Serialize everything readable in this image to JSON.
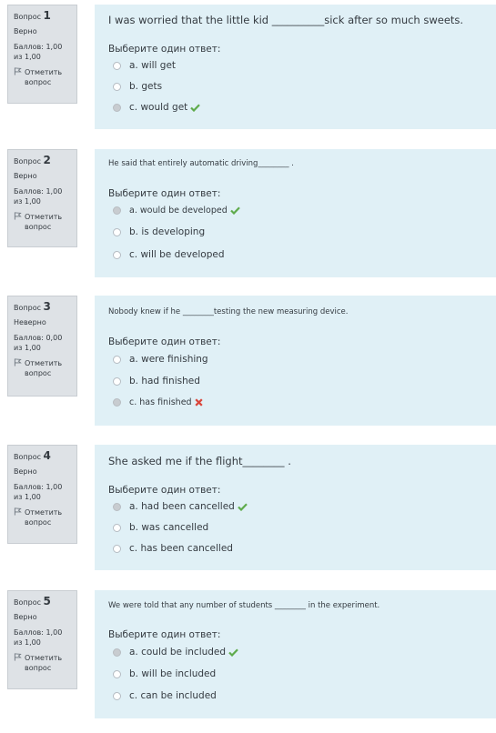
{
  "colors": {
    "info_bg": "#dee2e6",
    "content_bg": "#e0f0f6",
    "correct": "#5fab4c",
    "incorrect": "#d9463b"
  },
  "questions": [
    {
      "label": "Вопрос",
      "number": "1",
      "state": "Верно",
      "grade": "Баллов: 1,00 из 1,00",
      "flag_label": "Отметить вопрос",
      "text": "I was worried that the little kid __________sick after so much sweets.",
      "prompt": "Выберите один ответ:",
      "options": [
        {
          "label": "a. will get",
          "selected": false,
          "mark": ""
        },
        {
          "label": "b. gets",
          "selected": false,
          "mark": ""
        },
        {
          "label": "c. would get",
          "selected": true,
          "mark": "check-icon"
        }
      ]
    },
    {
      "label": "Вопрос",
      "number": "2",
      "state": "Верно",
      "grade": "Баллов: 1,00 из 1,00",
      "flag_label": "Отметить вопрос",
      "text": "He said that entirely automatic driving________ .",
      "prompt": "Выберите один ответ:",
      "options": [
        {
          "label": "a. would be developed",
          "selected": true,
          "mark": "check-icon"
        },
        {
          "label": "b. is developing",
          "selected": false,
          "mark": ""
        },
        {
          "label": "c. will be developed",
          "selected": false,
          "mark": ""
        }
      ]
    },
    {
      "label": "Вопрос",
      "number": "3",
      "state": "Неверно",
      "grade": "Баллов: 0,00 из 1,00",
      "flag_label": "Отметить вопрос",
      "text": "Nobody knew if he ________testing the new measuring device.",
      "prompt": "Выберите один ответ:",
      "options": [
        {
          "label": "a. were finishing",
          "selected": false,
          "mark": ""
        },
        {
          "label": "b. had finished",
          "selected": false,
          "mark": ""
        },
        {
          "label": "c. has finished",
          "selected": true,
          "mark": "cross-icon"
        }
      ]
    },
    {
      "label": "Вопрос",
      "number": "4",
      "state": "Верно",
      "grade": "Баллов: 1,00 из 1,00",
      "flag_label": "Отметить вопрос",
      "text": "She asked me if the flight________ .",
      "prompt": "Выберите один ответ:",
      "options": [
        {
          "label": "a. had been cancelled",
          "selected": true,
          "mark": "check-icon"
        },
        {
          "label": "b. was cancelled",
          "selected": false,
          "mark": ""
        },
        {
          "label": "c. has been cancelled",
          "selected": false,
          "mark": ""
        }
      ]
    },
    {
      "label": "Вопрос",
      "number": "5",
      "state": "Верно",
      "grade": "Баллов: 1,00 из 1,00",
      "flag_label": "Отметить вопрос",
      "text": "We were told that any number of students ________ in the experiment.",
      "prompt": "Выберите один ответ:",
      "options": [
        {
          "label": "a. could be included",
          "selected": true,
          "mark": "check-icon"
        },
        {
          "label": "b. will be included",
          "selected": false,
          "mark": ""
        },
        {
          "label": "c. can be included",
          "selected": false,
          "mark": ""
        }
      ]
    }
  ]
}
